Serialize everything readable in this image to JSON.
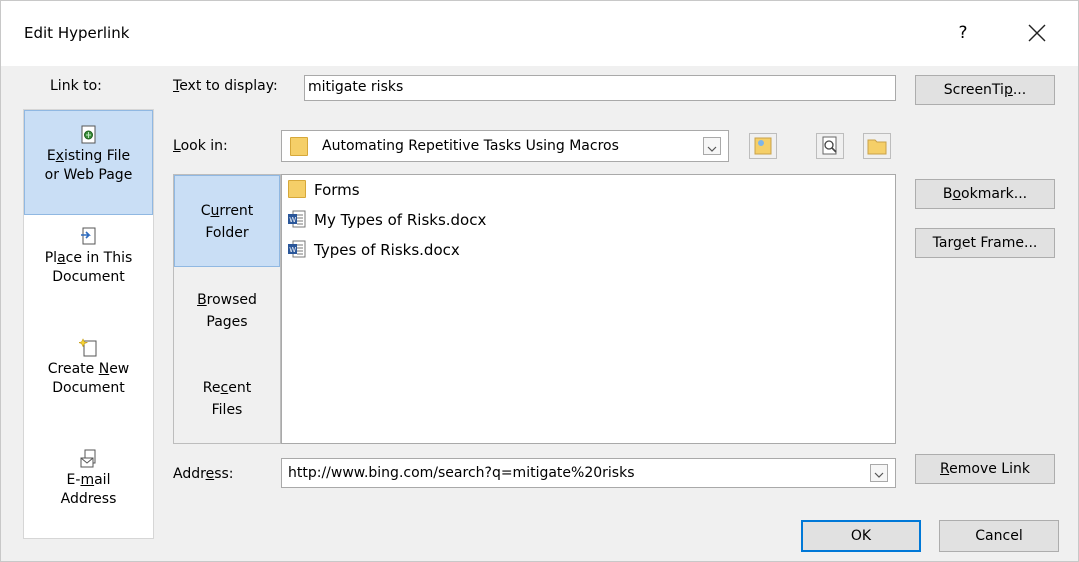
{
  "dialog": {
    "title": "Edit Hyperlink",
    "help": "?"
  },
  "link_to": {
    "label": "Link to:",
    "items": [
      {
        "line1_pre": "E",
        "line1_u": "x",
        "line1_post": "isting File",
        "line2": "or Web Page",
        "icon": "existing-file-icon",
        "selected": true
      },
      {
        "line1_pre": "Pl",
        "line1_u": "a",
        "line1_post": "ce in This",
        "line2": "Document",
        "icon": "place-in-document-icon",
        "selected": false
      },
      {
        "line1_pre": "Create ",
        "line1_u": "N",
        "line1_post": "ew",
        "line2": "Document",
        "icon": "create-new-document-icon",
        "selected": false
      },
      {
        "line1_pre": "E-",
        "line1_u": "m",
        "line1_post": "ail",
        "line2": "Address",
        "icon": "email-address-icon",
        "selected": false
      }
    ]
  },
  "text_to_display": {
    "label_u": "T",
    "label_rest": "ext to display:",
    "value": "mitigate risks"
  },
  "look_in": {
    "label_u": "L",
    "label_rest": "ook in:",
    "value": "Automating Repetitive Tasks Using Macros"
  },
  "browse_tabs": [
    {
      "pre": "C",
      "u": "u",
      "post": "rrent",
      "line2": "Folder",
      "selected": true
    },
    {
      "pre": "",
      "u": "B",
      "post": "rowsed",
      "line2": "Pages",
      "selected": false
    },
    {
      "pre": "Re",
      "u": "c",
      "post": "ent",
      "line2": "Files",
      "selected": false
    }
  ],
  "files": [
    {
      "name": "Forms",
      "icon": "folder-icon"
    },
    {
      "name": "My Types of Risks.docx",
      "icon": "word-document-icon"
    },
    {
      "name": "Types of Risks.docx",
      "icon": "word-document-icon"
    }
  ],
  "address": {
    "label_pre": "Addr",
    "label_u": "e",
    "label_post": "ss:",
    "value": "http://www.bing.com/search?q=mitigate%20risks"
  },
  "buttons": {
    "screentip_pre": "ScreenTi",
    "screentip_u": "p",
    "screentip_post": "...",
    "bookmark_pre": "B",
    "bookmark_u": "o",
    "bookmark_post": "okmark...",
    "target_pre": "Tar",
    "target_u": "g",
    "target_post": "et Frame...",
    "remove_u": "R",
    "remove_post": "emove Link",
    "ok": "OK",
    "cancel": "Cancel"
  },
  "colors": {
    "selected_bg": "#c9def5",
    "folder": "#f5cf68",
    "word_blue": "#2b579a",
    "default_button_border": "#0078d7"
  }
}
